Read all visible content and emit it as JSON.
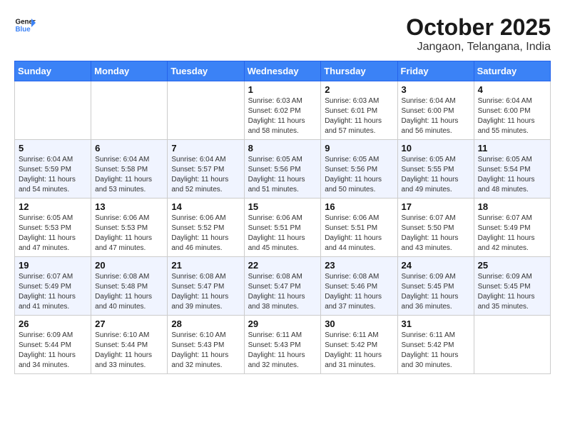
{
  "header": {
    "logo_line1": "General",
    "logo_line2": "Blue",
    "month": "October 2025",
    "location": "Jangaon, Telangana, India"
  },
  "days_of_week": [
    "Sunday",
    "Monday",
    "Tuesday",
    "Wednesday",
    "Thursday",
    "Friday",
    "Saturday"
  ],
  "weeks": [
    [
      {
        "day": "",
        "info": ""
      },
      {
        "day": "",
        "info": ""
      },
      {
        "day": "",
        "info": ""
      },
      {
        "day": "1",
        "info": "Sunrise: 6:03 AM\nSunset: 6:02 PM\nDaylight: 11 hours\nand 58 minutes."
      },
      {
        "day": "2",
        "info": "Sunrise: 6:03 AM\nSunset: 6:01 PM\nDaylight: 11 hours\nand 57 minutes."
      },
      {
        "day": "3",
        "info": "Sunrise: 6:04 AM\nSunset: 6:00 PM\nDaylight: 11 hours\nand 56 minutes."
      },
      {
        "day": "4",
        "info": "Sunrise: 6:04 AM\nSunset: 6:00 PM\nDaylight: 11 hours\nand 55 minutes."
      }
    ],
    [
      {
        "day": "5",
        "info": "Sunrise: 6:04 AM\nSunset: 5:59 PM\nDaylight: 11 hours\nand 54 minutes."
      },
      {
        "day": "6",
        "info": "Sunrise: 6:04 AM\nSunset: 5:58 PM\nDaylight: 11 hours\nand 53 minutes."
      },
      {
        "day": "7",
        "info": "Sunrise: 6:04 AM\nSunset: 5:57 PM\nDaylight: 11 hours\nand 52 minutes."
      },
      {
        "day": "8",
        "info": "Sunrise: 6:05 AM\nSunset: 5:56 PM\nDaylight: 11 hours\nand 51 minutes."
      },
      {
        "day": "9",
        "info": "Sunrise: 6:05 AM\nSunset: 5:56 PM\nDaylight: 11 hours\nand 50 minutes."
      },
      {
        "day": "10",
        "info": "Sunrise: 6:05 AM\nSunset: 5:55 PM\nDaylight: 11 hours\nand 49 minutes."
      },
      {
        "day": "11",
        "info": "Sunrise: 6:05 AM\nSunset: 5:54 PM\nDaylight: 11 hours\nand 48 minutes."
      }
    ],
    [
      {
        "day": "12",
        "info": "Sunrise: 6:05 AM\nSunset: 5:53 PM\nDaylight: 11 hours\nand 47 minutes."
      },
      {
        "day": "13",
        "info": "Sunrise: 6:06 AM\nSunset: 5:53 PM\nDaylight: 11 hours\nand 47 minutes."
      },
      {
        "day": "14",
        "info": "Sunrise: 6:06 AM\nSunset: 5:52 PM\nDaylight: 11 hours\nand 46 minutes."
      },
      {
        "day": "15",
        "info": "Sunrise: 6:06 AM\nSunset: 5:51 PM\nDaylight: 11 hours\nand 45 minutes."
      },
      {
        "day": "16",
        "info": "Sunrise: 6:06 AM\nSunset: 5:51 PM\nDaylight: 11 hours\nand 44 minutes."
      },
      {
        "day": "17",
        "info": "Sunrise: 6:07 AM\nSunset: 5:50 PM\nDaylight: 11 hours\nand 43 minutes."
      },
      {
        "day": "18",
        "info": "Sunrise: 6:07 AM\nSunset: 5:49 PM\nDaylight: 11 hours\nand 42 minutes."
      }
    ],
    [
      {
        "day": "19",
        "info": "Sunrise: 6:07 AM\nSunset: 5:49 PM\nDaylight: 11 hours\nand 41 minutes."
      },
      {
        "day": "20",
        "info": "Sunrise: 6:08 AM\nSunset: 5:48 PM\nDaylight: 11 hours\nand 40 minutes."
      },
      {
        "day": "21",
        "info": "Sunrise: 6:08 AM\nSunset: 5:47 PM\nDaylight: 11 hours\nand 39 minutes."
      },
      {
        "day": "22",
        "info": "Sunrise: 6:08 AM\nSunset: 5:47 PM\nDaylight: 11 hours\nand 38 minutes."
      },
      {
        "day": "23",
        "info": "Sunrise: 6:08 AM\nSunset: 5:46 PM\nDaylight: 11 hours\nand 37 minutes."
      },
      {
        "day": "24",
        "info": "Sunrise: 6:09 AM\nSunset: 5:45 PM\nDaylight: 11 hours\nand 36 minutes."
      },
      {
        "day": "25",
        "info": "Sunrise: 6:09 AM\nSunset: 5:45 PM\nDaylight: 11 hours\nand 35 minutes."
      }
    ],
    [
      {
        "day": "26",
        "info": "Sunrise: 6:09 AM\nSunset: 5:44 PM\nDaylight: 11 hours\nand 34 minutes."
      },
      {
        "day": "27",
        "info": "Sunrise: 6:10 AM\nSunset: 5:44 PM\nDaylight: 11 hours\nand 33 minutes."
      },
      {
        "day": "28",
        "info": "Sunrise: 6:10 AM\nSunset: 5:43 PM\nDaylight: 11 hours\nand 32 minutes."
      },
      {
        "day": "29",
        "info": "Sunrise: 6:11 AM\nSunset: 5:43 PM\nDaylight: 11 hours\nand 32 minutes."
      },
      {
        "day": "30",
        "info": "Sunrise: 6:11 AM\nSunset: 5:42 PM\nDaylight: 11 hours\nand 31 minutes."
      },
      {
        "day": "31",
        "info": "Sunrise: 6:11 AM\nSunset: 5:42 PM\nDaylight: 11 hours\nand 30 minutes."
      },
      {
        "day": "",
        "info": ""
      }
    ]
  ]
}
